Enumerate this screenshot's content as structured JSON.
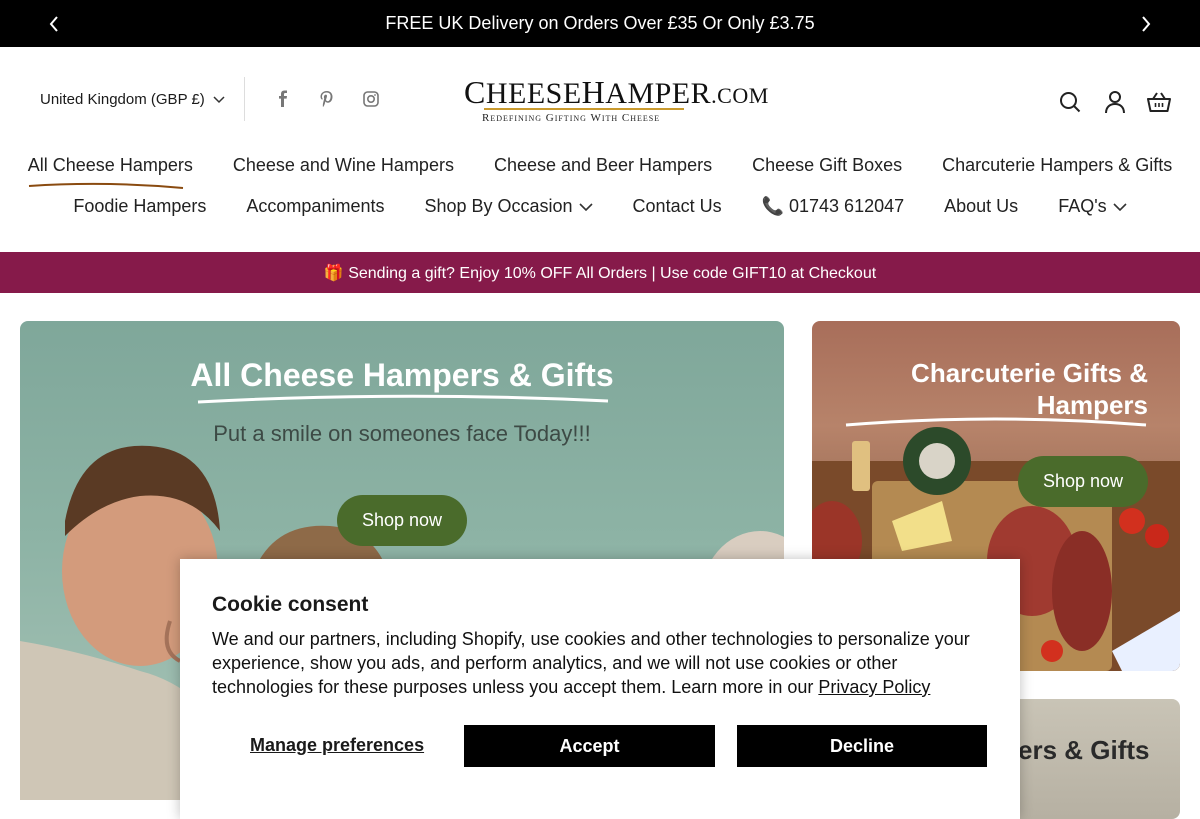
{
  "announcement": {
    "text": "FREE UK Delivery on Orders Over £35 Or Only £3.75"
  },
  "header": {
    "locale": "United Kingdom (GBP £)",
    "logo": {
      "text_cap1": "C",
      "text_part1": "HEESE",
      "text_cap2": "H",
      "text_part2": "AMPER",
      "suffix": ".COM",
      "tagline": "Redefining Gifting With Cheese"
    }
  },
  "nav": {
    "row1": [
      "All Cheese Hampers",
      "Cheese and Wine Hampers",
      "Cheese and Beer Hampers",
      "Cheese Gift Boxes",
      "Charcuterie Hampers & Gifts"
    ],
    "row2": [
      "Foodie Hampers",
      "Accompaniments",
      "Shop By Occasion",
      "Contact Us",
      "📞 01743 612047",
      "About Us",
      "FAQ's"
    ]
  },
  "promo": {
    "text": "🎁 Sending a gift? Enjoy 10% OFF All Orders | Use code GIFT10 at Checkout"
  },
  "hero": {
    "title": "All Cheese Hampers & Gifts",
    "subtitle": "Put a smile on someones face Today!!!",
    "button": "Shop now"
  },
  "side1": {
    "title": "Charcuterie Gifts & Hampers",
    "button": "Shop now"
  },
  "side2": {
    "title": "ers & Gifts"
  },
  "cookie": {
    "title": "Cookie consent",
    "body": "We and our partners, including Shopify, use cookies and other technologies to personalize your experience, show you ads, and perform analytics, and we will not use cookies or other technologies for these purposes unless you accept them. Learn more in our ",
    "link": "Privacy Policy",
    "manage": "Manage preferences",
    "accept": "Accept",
    "decline": "Decline"
  },
  "colors": {
    "promo_bg": "#861a4a",
    "button_green": "#4a6b2b",
    "underline": "#8a4b10"
  }
}
